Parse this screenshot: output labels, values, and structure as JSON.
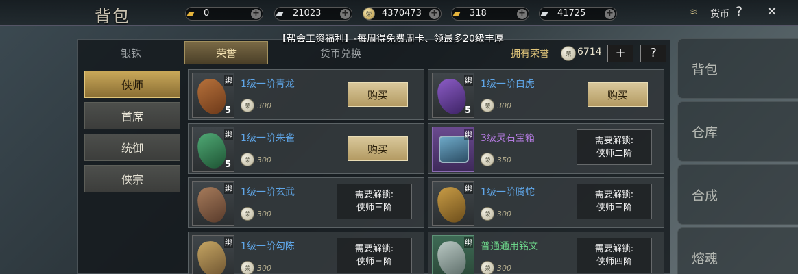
{
  "header": {
    "title": "背包",
    "currencies": [
      {
        "icon": "gold-ingot-icon",
        "value": "0"
      },
      {
        "icon": "silver-ingot-icon",
        "value": "21023"
      },
      {
        "icon": "coin-icon",
        "value": "4370473"
      },
      {
        "icon": "gold-ingot-icon",
        "value": "318"
      },
      {
        "icon": "silver-ingot-icon",
        "value": "41725"
      }
    ],
    "currency_label": "货币",
    "help": "?",
    "close": "✕"
  },
  "banner": "【帮会工资福利】-每周得免费周卡、领最多20级丰厚",
  "tabs": [
    "银铢",
    "荣誉",
    "货币兑换"
  ],
  "owned_label": "拥有荣誉",
  "owned_value": "6714",
  "plus_btn": "+",
  "help_btn": "?",
  "coin_char": "荣",
  "sidebar": [
    "侠师",
    "首席",
    "统御",
    "侠宗"
  ],
  "items": [
    {
      "name": "1级一阶青龙",
      "price": "300",
      "qty": "5",
      "bind": "绑",
      "action": "购买"
    },
    {
      "name": "1级一阶白虎",
      "price": "300",
      "qty": "5",
      "bind": "绑",
      "action": "购买"
    },
    {
      "name": "1级一阶朱雀",
      "price": "300",
      "qty": "5",
      "bind": "绑",
      "action": "购买"
    },
    {
      "name": "3级灵石宝箱",
      "price": "350",
      "bind": "绑",
      "lock1": "需要解锁:",
      "lock2": "侠师二阶"
    },
    {
      "name": "1级一阶玄武",
      "price": "300",
      "bind": "绑",
      "lock1": "需要解锁:",
      "lock2": "侠师三阶"
    },
    {
      "name": "1级一阶腾蛇",
      "price": "300",
      "bind": "绑",
      "lock1": "需要解锁:",
      "lock2": "侠师三阶"
    },
    {
      "name": "1级一阶勾陈",
      "price": "300",
      "bind": "绑",
      "lock1": "需要解锁:",
      "lock2": "侠师三阶"
    },
    {
      "name": "普通通用铭文",
      "price": "300",
      "bind": "绑",
      "lock1": "需要解锁:",
      "lock2": "侠师四阶"
    }
  ],
  "right_nav": [
    "背包",
    "仓库",
    "合成",
    "熔魂"
  ]
}
